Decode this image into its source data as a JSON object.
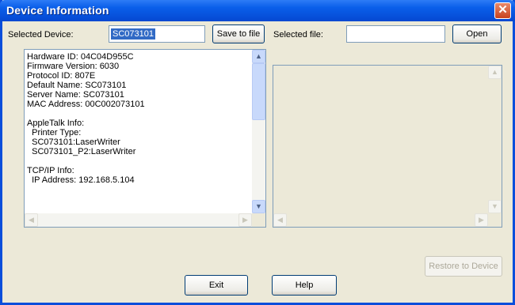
{
  "window": {
    "title": "Device Information",
    "close_glyph": "✕"
  },
  "left": {
    "selected_device_label": "Selected Device:",
    "selected_device_value": "SC073101",
    "save_button": "Save to file",
    "info_text": "Hardware ID: 04C04D955C\nFirmware Version: 6030\nProtocol ID: 807E\nDefault Name: SC073101\nServer Name: SC073101\nMAC Address: 00C002073101\n\nAppleTalk Info:\n  Printer Type:\n  SC073101:LaserWriter\n  SC073101_P2:LaserWriter\n\nTCP/IP Info:\n  IP Address: 192.168.5.104"
  },
  "right": {
    "selected_file_label": "Selected file:",
    "selected_file_value": "",
    "open_button": "Open",
    "restore_button": "Restore to Device"
  },
  "footer": {
    "exit_button": "Exit",
    "help_button": "Help"
  },
  "icons": {
    "up": "▲",
    "down": "▼",
    "left": "◀",
    "right": "▶"
  }
}
